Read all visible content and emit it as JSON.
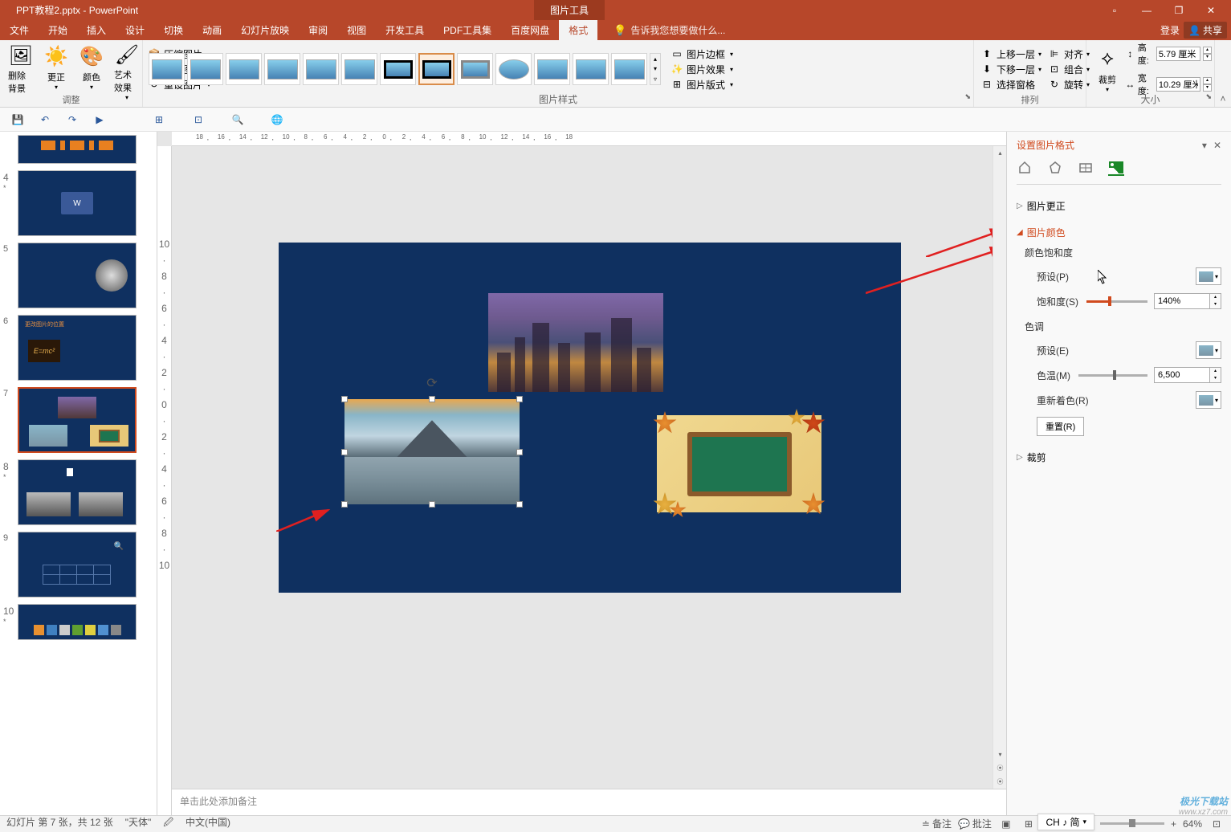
{
  "title": {
    "filename": "PPT教程2.pptx - PowerPoint",
    "tool_tab": "图片工具"
  },
  "window_buttons": {
    "ribbon_opts": "▫",
    "min": "—",
    "restore": "❐",
    "close": "✕"
  },
  "menu": {
    "file": "文件",
    "home": "开始",
    "insert": "插入",
    "design": "设计",
    "transitions": "切换",
    "animations": "动画",
    "slideshow": "幻灯片放映",
    "review": "审阅",
    "view": "视图",
    "developer": "开发工具",
    "pdf": "PDF工具集",
    "baidu": "百度网盘",
    "format": "格式",
    "tell_me": "告诉我您想要做什么...",
    "login": "登录",
    "share": "共享"
  },
  "ribbon": {
    "remove_bg": "删除背景",
    "corrections": "更正",
    "color": "颜色",
    "artistic": "艺术效果",
    "compress": "压缩图片",
    "change": "更改图片",
    "reset": "重设图片",
    "adjust_group": "调整",
    "styles_group": "图片样式",
    "border": "图片边框",
    "effects": "图片效果",
    "layout": "图片版式",
    "bring_forward": "上移一层",
    "send_backward": "下移一层",
    "selection_pane": "选择窗格",
    "align": "对齐",
    "group": "组合",
    "rotate": "旋转",
    "arrange_group": "排列",
    "crop": "裁剪",
    "height_label": "高度:",
    "height_value": "5.79 厘米",
    "width_label": "宽度:",
    "width_value": "10.29 厘米",
    "size_group": "大小"
  },
  "slides": {
    "nums": [
      "4",
      "5",
      "6",
      "7",
      "8",
      "9",
      "10"
    ]
  },
  "notes_placeholder": "单击此处添加备注",
  "ruler_h_values": [
    "18",
    "",
    "16",
    "",
    "14",
    "",
    "12",
    "",
    "10",
    "",
    "8",
    "",
    "6",
    "",
    "4",
    "",
    "2",
    "",
    "0",
    "",
    "2",
    "",
    "4",
    "",
    "6",
    "",
    "8",
    "",
    "10",
    "",
    "12",
    "",
    "14",
    "",
    "16",
    "",
    "18"
  ],
  "format_pane": {
    "title": "设置图片格式",
    "pic_corrections": "图片更正",
    "pic_color": "图片颜色",
    "saturation_group": "颜色饱和度",
    "preset_label": "预设(P)",
    "saturation_label": "饱和度(S)",
    "saturation_value": "140%",
    "tone_group": "色调",
    "preset2_label": "预设(E)",
    "temp_label": "色温(M)",
    "temp_value": "6,500",
    "recolor_label": "重新着色(R)",
    "reset_btn": "重置(R)",
    "crop_section": "裁剪"
  },
  "status": {
    "slide_info": "幻灯片 第 7 张，共 12 张",
    "theme": "\"天体\"",
    "lang": "中文(中国)",
    "notes": "备注",
    "comments": "批注",
    "zoom": "64%"
  },
  "ime": "CH ♪ 简",
  "watermark": {
    "line1": "极光下载站",
    "line2": "www.xz7.com"
  }
}
